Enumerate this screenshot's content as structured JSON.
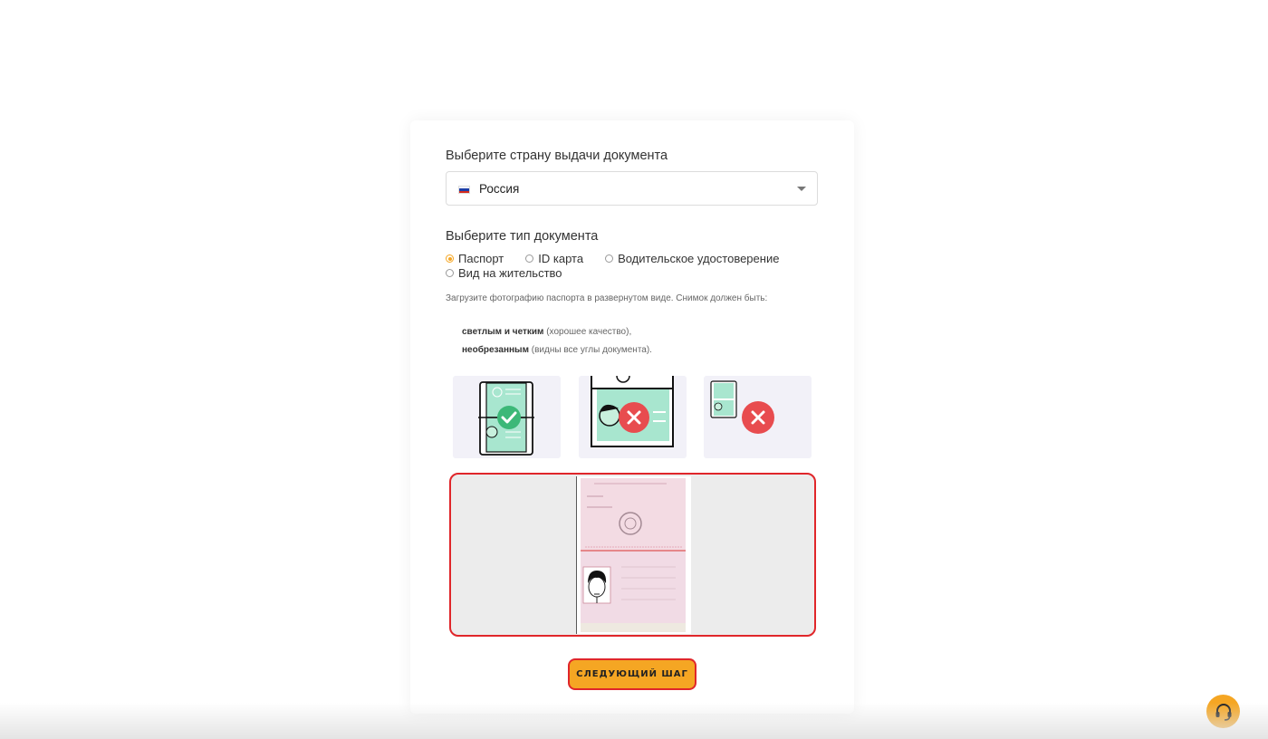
{
  "country_label": "Выберите страну выдачи документа",
  "country_select": {
    "value": "Россия",
    "flag_colors": [
      "#ffffff",
      "#1c3fa8",
      "#d52b1e"
    ]
  },
  "doctype_label": "Выберите тип документа",
  "doc_types": [
    {
      "label": "Паспорт",
      "selected": true
    },
    {
      "label": "ID карта",
      "selected": false
    },
    {
      "label": "Водительское удостоверение",
      "selected": false
    },
    {
      "label": "Вид на жительство",
      "selected": false
    }
  ],
  "upload_hint": "Загрузите фотографию паспорта в развернутом виде. Снимок должен быть:",
  "requirements": [
    {
      "bold": "светлым и четким",
      "rest": " (хорошее качество),"
    },
    {
      "bold": "необрезанным",
      "rest": " (видны все углы документа)."
    }
  ],
  "next_button": "СЛЕДУЮЩИЙ ШАГ",
  "colors": {
    "accent": "#f5a623",
    "error_red": "#e0262a",
    "ok_green": "#3cb878",
    "mint": "#a8e6cf"
  },
  "icons": [
    "chevron-down-icon",
    "check-icon",
    "cross-icon",
    "headset-icon"
  ]
}
